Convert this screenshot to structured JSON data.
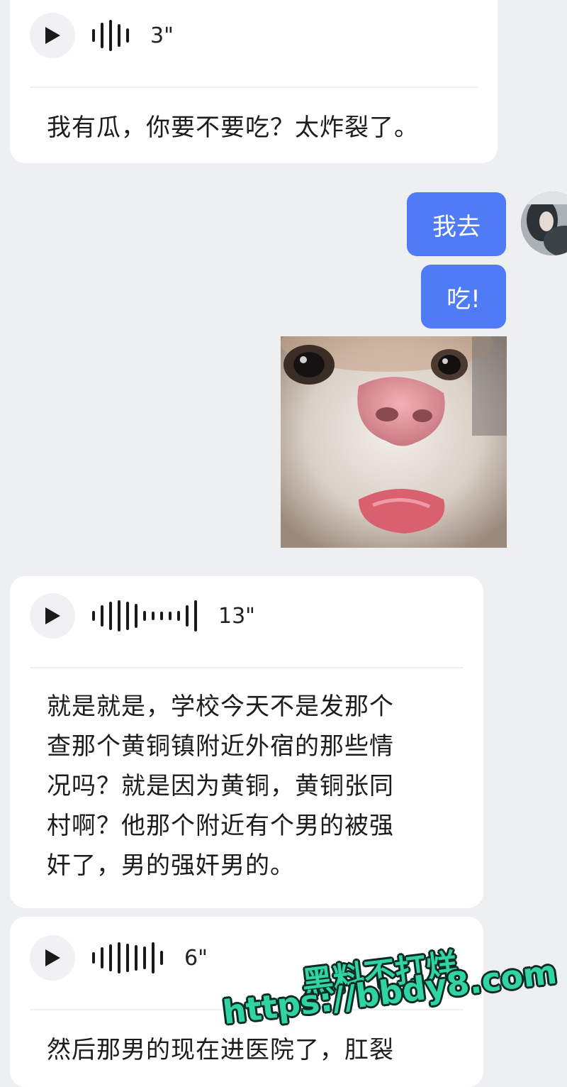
{
  "messages": [
    {
      "duration": "3\"",
      "text": "我有瓜，你要不要吃？太炸裂了。"
    },
    {
      "duration": "13\"",
      "text": "就是就是，学校今天不是发那个\n查那个黄铜镇附近外宿的那些情\n况吗？就是因为黄铜，黄铜张同\n村啊？他那个附近有个男的被强\n奸了，男的强奸男的。"
    },
    {
      "duration": "6\"",
      "text": "然后那男的现在进医院了，肛裂"
    }
  ],
  "outgoing": [
    "我去",
    "吃!"
  ],
  "watermark": {
    "line1": "黑料不打烊",
    "line2": "https://bbdy8.com"
  },
  "colors": {
    "background": "#eeeff1",
    "incoming_bubble": "#ffffff",
    "outgoing_bubble": "#4f7cf6",
    "watermark": "#2fd3a4"
  },
  "icons": {
    "play": "play-icon",
    "waveform": "voice-waveform-icon"
  }
}
